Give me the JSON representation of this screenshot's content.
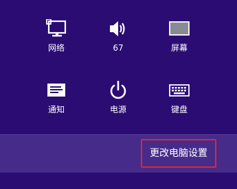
{
  "settings_panel": {
    "tiles": [
      {
        "icon": "network-icon",
        "label": "网络"
      },
      {
        "icon": "volume-icon",
        "label": "67"
      },
      {
        "icon": "screen-brightness-icon",
        "label": "屏幕"
      },
      {
        "icon": "notifications-icon",
        "label": "通知"
      },
      {
        "icon": "power-icon",
        "label": "电源"
      },
      {
        "icon": "keyboard-icon",
        "label": "键盘"
      }
    ],
    "change_pc_settings_label": "更改电脑设置"
  },
  "colors": {
    "background": "#2a0c72",
    "bottom_bar": "#472b8a",
    "highlight_border": "#e3262b"
  }
}
